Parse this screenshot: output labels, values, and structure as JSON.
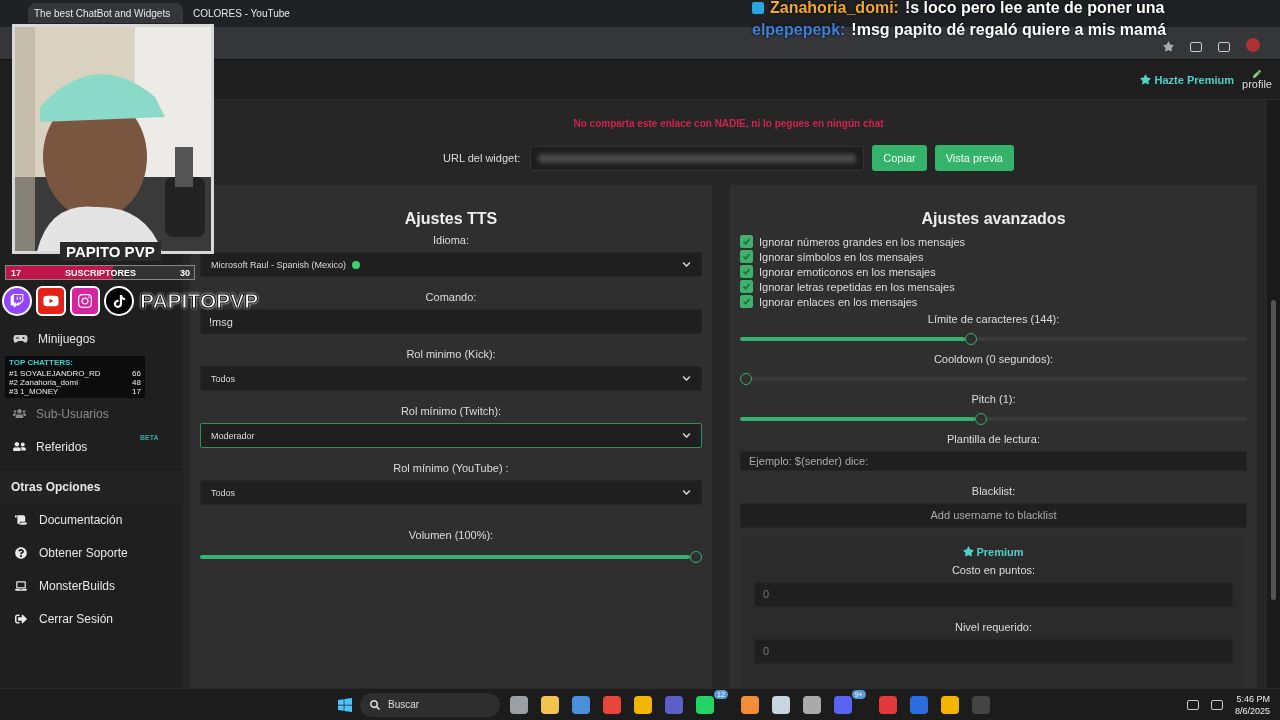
{
  "browser": {
    "tabs": [
      {
        "title": "The best ChatBot and Widgets",
        "selected": true
      },
      {
        "title": "COLORES - YouTube",
        "selected": false
      }
    ]
  },
  "stream_overlay": {
    "chat": [
      {
        "user": "Zanahoria_domi:",
        "message": "!s loco pero lee ante de poner una",
        "color": "#f0a830"
      },
      {
        "user": "elpepepepk:",
        "message": "!msg papito dé regaló quiere a mis mamá",
        "color": "#3f7fd8"
      }
    ],
    "streamer_name": "PAPITO PVP",
    "sub_goal": {
      "current": "17",
      "label": "SUSCRIPTORES",
      "target": "30",
      "level": 0.57
    },
    "handle": "PAPITOPVP",
    "top_chatters": {
      "title": "TOP CHATTERS:",
      "rows": [
        {
          "name": "#1 SOYALEJANDRO_RD",
          "count": "66"
        },
        {
          "name": "#2 Zanahoria_domi",
          "count": "48"
        },
        {
          "name": "#3 1_MONEY",
          "count": "17"
        }
      ]
    }
  },
  "header": {
    "premium": "Hazte Premium",
    "profile": "profile"
  },
  "sidebar": {
    "items": [
      {
        "label": "Minijuegos",
        "disabled": false
      },
      {
        "label": "Sub-Usuarios",
        "disabled": true
      },
      {
        "label": "Referidos",
        "disabled": false,
        "badge": "BETA"
      }
    ],
    "section": "Otras Opciones",
    "options": [
      {
        "label": "Documentación"
      },
      {
        "label": "Obtener Soporte"
      },
      {
        "label": "MonsterBuilds"
      },
      {
        "label": "Cerrar Sesión"
      }
    ]
  },
  "warning": "No comparta este enlace con NADIE, ni lo pegues en ningún chat",
  "widget_url": {
    "label": "URL del widget:",
    "buttons": [
      "Copiar",
      "Vista previa"
    ]
  },
  "tts": {
    "title": "Ajustes TTS",
    "fields": [
      {
        "kind": "select",
        "label": "Idioma:",
        "value": "Microsoft Raul - Spanish (Mexico)",
        "color": "#3ecf6e",
        "focused": false
      },
      {
        "kind": "text",
        "label": "Comando:",
        "value": "!msg",
        "focused": false
      },
      {
        "kind": "select",
        "label": "Rol minimo (Kick):",
        "value": "Todos",
        "focused": false
      },
      {
        "kind": "select",
        "label": "Rol mínimo (Twitch):",
        "value": "Moderador",
        "focused": true
      },
      {
        "kind": "select",
        "label": "Rol mínimo (YouTube) :",
        "value": "Todos",
        "focused": false
      },
      {
        "kind": "slider",
        "label": "Volumen (100%):",
        "level": 1
      }
    ]
  },
  "advanced": {
    "title": "Ajustes avanzados",
    "checks": [
      {
        "label": "Ignorar números grandes en los mensajes",
        "checked": true
      },
      {
        "label": "Ignorar símbolos en los mensajes",
        "checked": true
      },
      {
        "label": "Ignorar emoticonos en los mensajes",
        "checked": true
      },
      {
        "label": "Ignorar letras repetidas en los mensajes",
        "checked": true
      },
      {
        "label": "Ignorar enlaces en los mensajes",
        "checked": true
      }
    ],
    "sliders": [
      {
        "label": "Límite de caracteres (144):",
        "level": 0.455
      },
      {
        "label": "Cooldown (0 segundos):",
        "level": 0
      },
      {
        "label": "Pitch (1):",
        "level": 0.475
      }
    ],
    "template": {
      "label": "Plantilla de lectura:",
      "placeholder": "Ejemplo: $(sender) dice:"
    },
    "blacklist": {
      "label": "Blacklist:",
      "placeholder": "Add username to blacklist"
    },
    "premium": {
      "title": "Premium",
      "fields": [
        {
          "label": "Costo en puntos:",
          "placeholder": "0"
        },
        {
          "label": "Nivel requerido:",
          "placeholder": "0"
        }
      ]
    }
  },
  "taskbar": {
    "search": "Buscar",
    "apps": [
      {
        "color": "#9aa0a6"
      },
      {
        "color": "#f2c14e"
      },
      {
        "color": "#4a90d9"
      },
      {
        "color": "#e8453c"
      },
      {
        "color": "#f2b500"
      },
      {
        "color": "#5b5fc7"
      },
      {
        "color": "#25d366",
        "badge": "12"
      },
      {
        "color": "#f28c38"
      },
      {
        "color": "#c7d5e0"
      },
      {
        "color": "#aaaaaa"
      },
      {
        "color": "#5865f2",
        "badge": "9+"
      },
      {
        "color": "#e03a3a"
      },
      {
        "color": "#2d6cdf"
      },
      {
        "color": "#f2b500"
      },
      {
        "color": "#444444"
      }
    ],
    "time": "5:46 PM",
    "date": "8/6/2025"
  }
}
